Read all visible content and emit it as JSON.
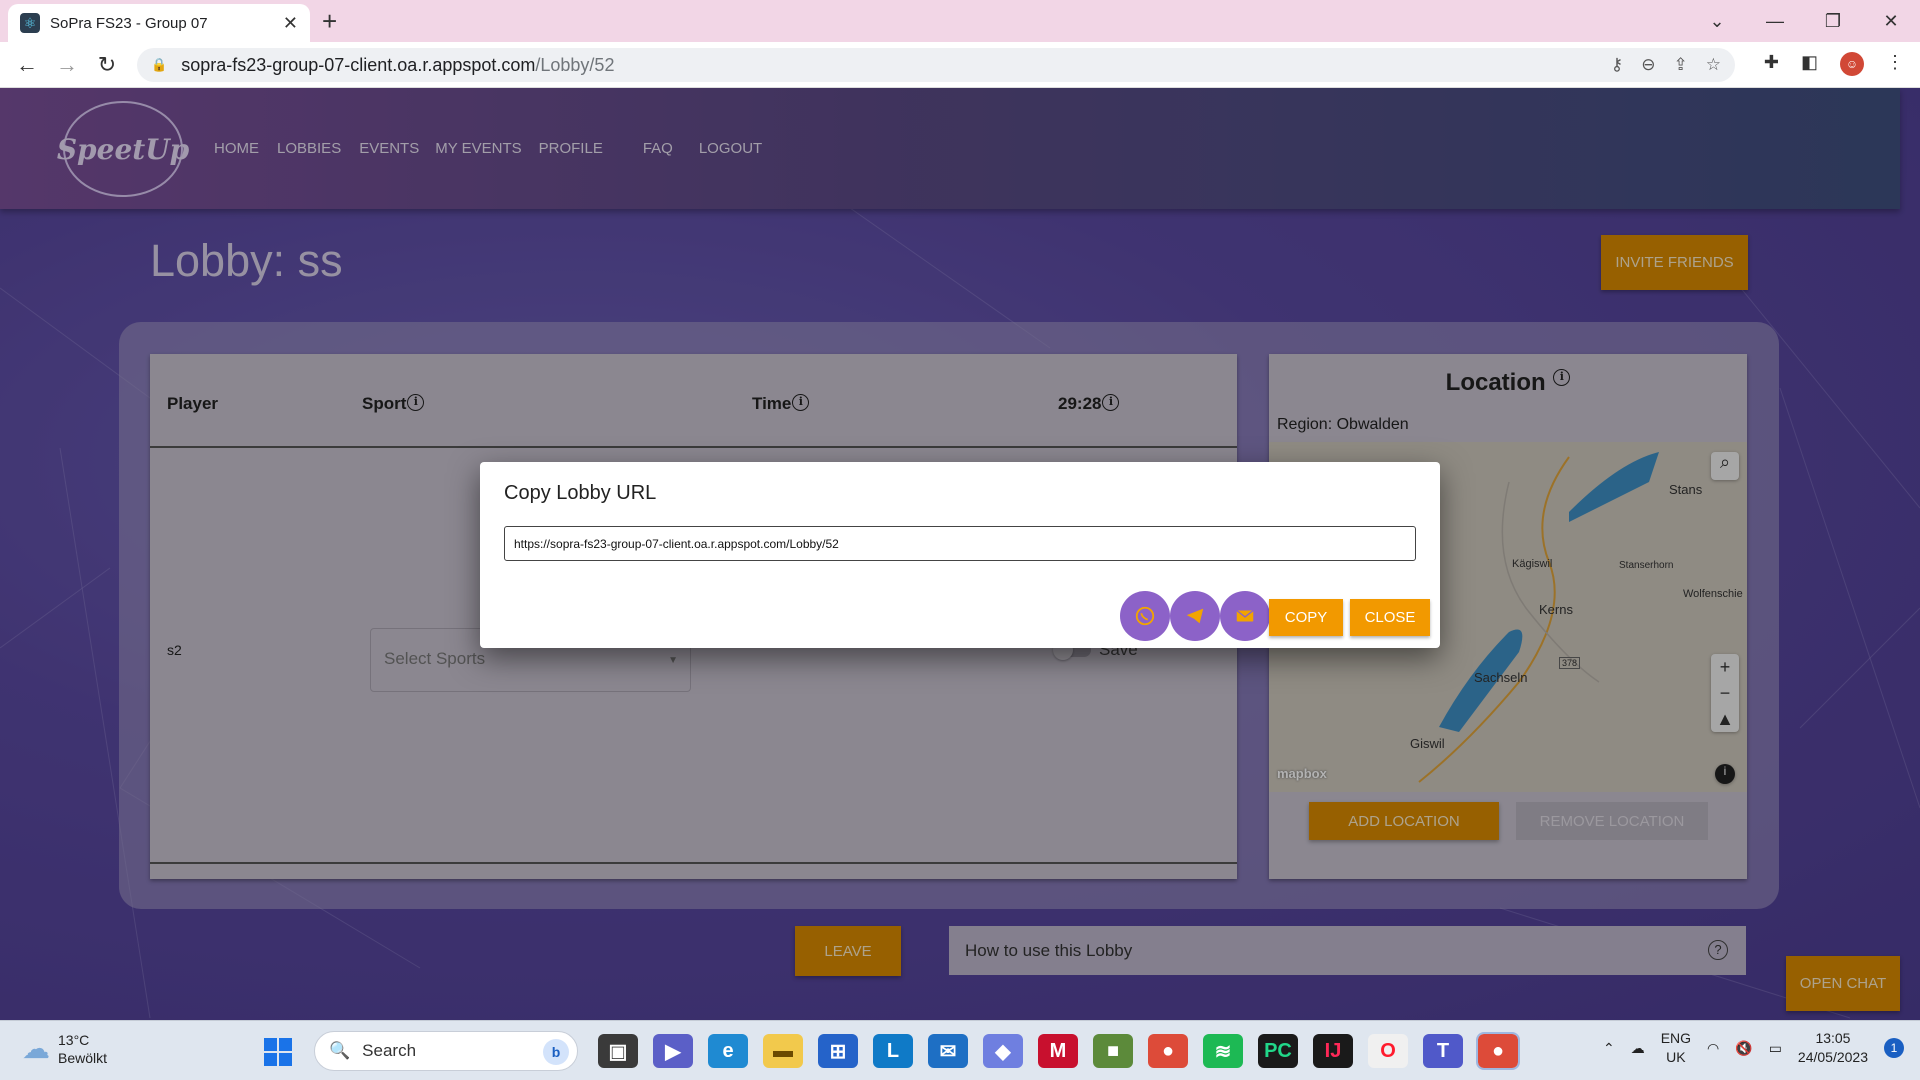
{
  "browser": {
    "tab_title": "SoPra FS23 - Group 07",
    "new_tab": "+",
    "tab_close": "✕",
    "url_host": "sopra-fs23-group-07-client.oa.r.appspot.com",
    "url_path": "/Lobby/52",
    "window_controls": [
      "⌄",
      "—",
      "❐",
      "✕"
    ]
  },
  "app": {
    "logo": "SpeetUp",
    "nav": [
      "HOME",
      "LOBBIES",
      "EVENTS",
      "MY EVENTS",
      "PROFILE",
      "FAQ",
      "LOGOUT"
    ],
    "lobby_title": "Lobby: ss",
    "invite_button": "INVITE FRIENDS",
    "table": {
      "headers": {
        "player": "Player",
        "sport": "Sport",
        "time": "Time",
        "timer": "29:28"
      },
      "row": {
        "player": "s2",
        "sport_placeholder": "Select Sports",
        "save_label": "Save"
      }
    },
    "location": {
      "title": "Location",
      "region": "Region: Obwalden",
      "map_labels": [
        "Stans",
        "Kägiswil",
        "Stanserhorn",
        "Kerns",
        "Wolfenschie",
        "Sachseln",
        "Giswil",
        "378"
      ],
      "map_attribution": "mapbox",
      "add_button": "ADD LOCATION",
      "remove_button": "REMOVE LOCATION"
    },
    "leave_button": "LEAVE",
    "howto_text": "How to use this Lobby",
    "open_chat_button": "OPEN CHAT"
  },
  "modal": {
    "title": "Copy Lobby URL",
    "url_value": "https://sopra-fs23-group-07-client.oa.r.appspot.com/Lobby/52",
    "share_icons": [
      "whatsapp-icon",
      "telegram-icon",
      "email-icon"
    ],
    "copy_button": "COPY",
    "close_button": "CLOSE"
  },
  "taskbar": {
    "temperature": "13°C",
    "weather": "Bewölkt",
    "search_label": "Search",
    "language_top": "ENG",
    "language_bottom": "UK",
    "time": "13:05",
    "date": "24/05/2023",
    "notifications": "1"
  },
  "colors": {
    "accent_orange": "#f29900",
    "share_purple": "#8c62c8",
    "page_purple": "#5b4aa2"
  }
}
